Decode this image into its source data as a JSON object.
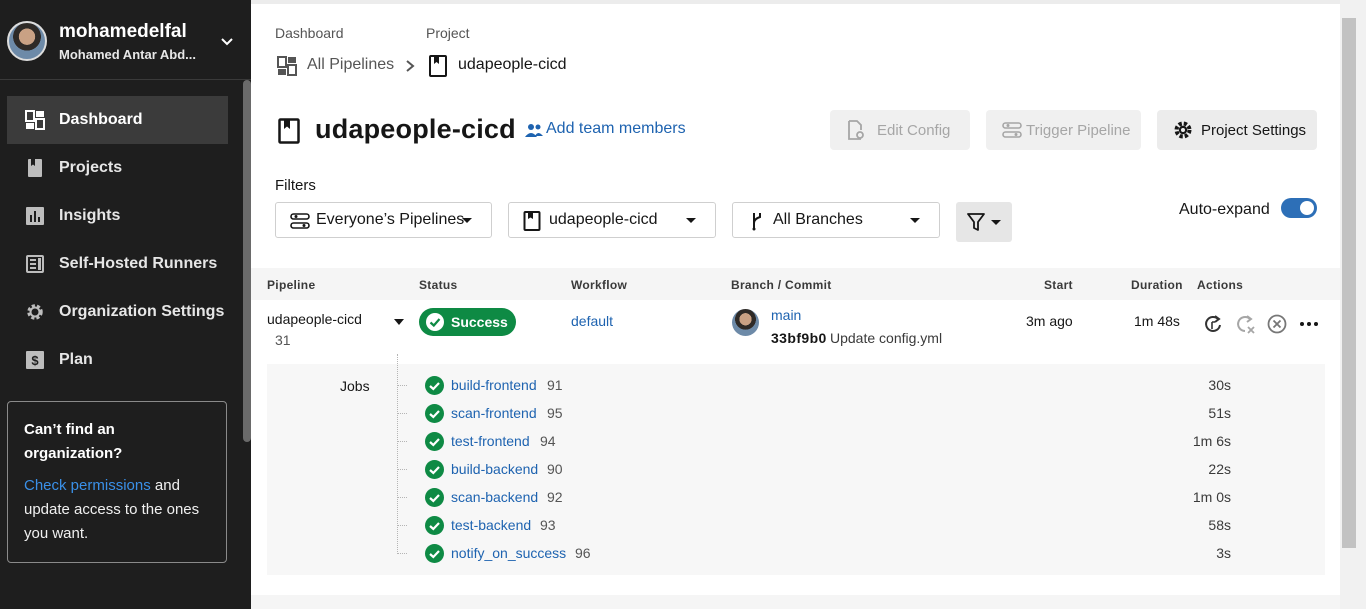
{
  "sidebar": {
    "org_name": "mohamedelfal",
    "user_name": "Mohamed Antar Abd...",
    "nav": [
      {
        "label": "Dashboard",
        "icon": "dashboard-icon"
      },
      {
        "label": "Projects",
        "icon": "projects-icon"
      },
      {
        "label": "Insights",
        "icon": "insights-icon"
      },
      {
        "label": "Self-Hosted Runners",
        "icon": "runners-icon"
      },
      {
        "label": "Organization Settings",
        "icon": "gear-icon"
      },
      {
        "label": "Plan",
        "icon": "plan-icon"
      }
    ],
    "help": {
      "title": "Can’t find an organization?",
      "link": "Check permissions",
      "text_after": " and update access to the ones you want."
    }
  },
  "breadcrumb": {
    "dashboard_label": "Dashboard",
    "project_label": "Project",
    "all_pipelines": "All Pipelines",
    "project_name": "udapeople-cicd"
  },
  "header": {
    "title": "udapeople-cicd",
    "add_team": "Add team members",
    "edit_config": "Edit Config",
    "trigger_pipeline": "Trigger Pipeline",
    "project_settings": "Project Settings"
  },
  "filters": {
    "label": "Filters",
    "pipelines": "Everyone’s Pipelines",
    "project": "udapeople-cicd",
    "branches": "All Branches",
    "auto_expand": "Auto-expand",
    "auto_expand_on": true
  },
  "table": {
    "headers": {
      "pipeline": "Pipeline",
      "status": "Status",
      "workflow": "Workflow",
      "branch_commit": "Branch / Commit",
      "start": "Start",
      "duration": "Duration",
      "actions": "Actions"
    },
    "row": {
      "pipeline": "udapeople-cicd",
      "number": "31",
      "status": "Success",
      "workflow": "default",
      "branch": "main",
      "commit_hash": "33bf9b0",
      "commit_msg": "Update config.yml",
      "start": "3m ago",
      "duration": "1m 48s"
    },
    "jobs_label": "Jobs",
    "jobs": [
      {
        "name": "build-frontend",
        "num": "91",
        "duration": "30s"
      },
      {
        "name": "scan-frontend",
        "num": "95",
        "duration": "51s"
      },
      {
        "name": "test-frontend",
        "num": "94",
        "duration": "1m 6s"
      },
      {
        "name": "build-backend",
        "num": "90",
        "duration": "22s"
      },
      {
        "name": "scan-backend",
        "num": "92",
        "duration": "1m 0s"
      },
      {
        "name": "test-backend",
        "num": "93",
        "duration": "58s"
      },
      {
        "name": "notify_on_success",
        "num": "96",
        "duration": "3s"
      }
    ]
  },
  "colors": {
    "success": "#0e8a44",
    "link": "#1e63b0",
    "toggle": "#2d6fb7",
    "sidebar_bg": "#1e1e1e"
  }
}
